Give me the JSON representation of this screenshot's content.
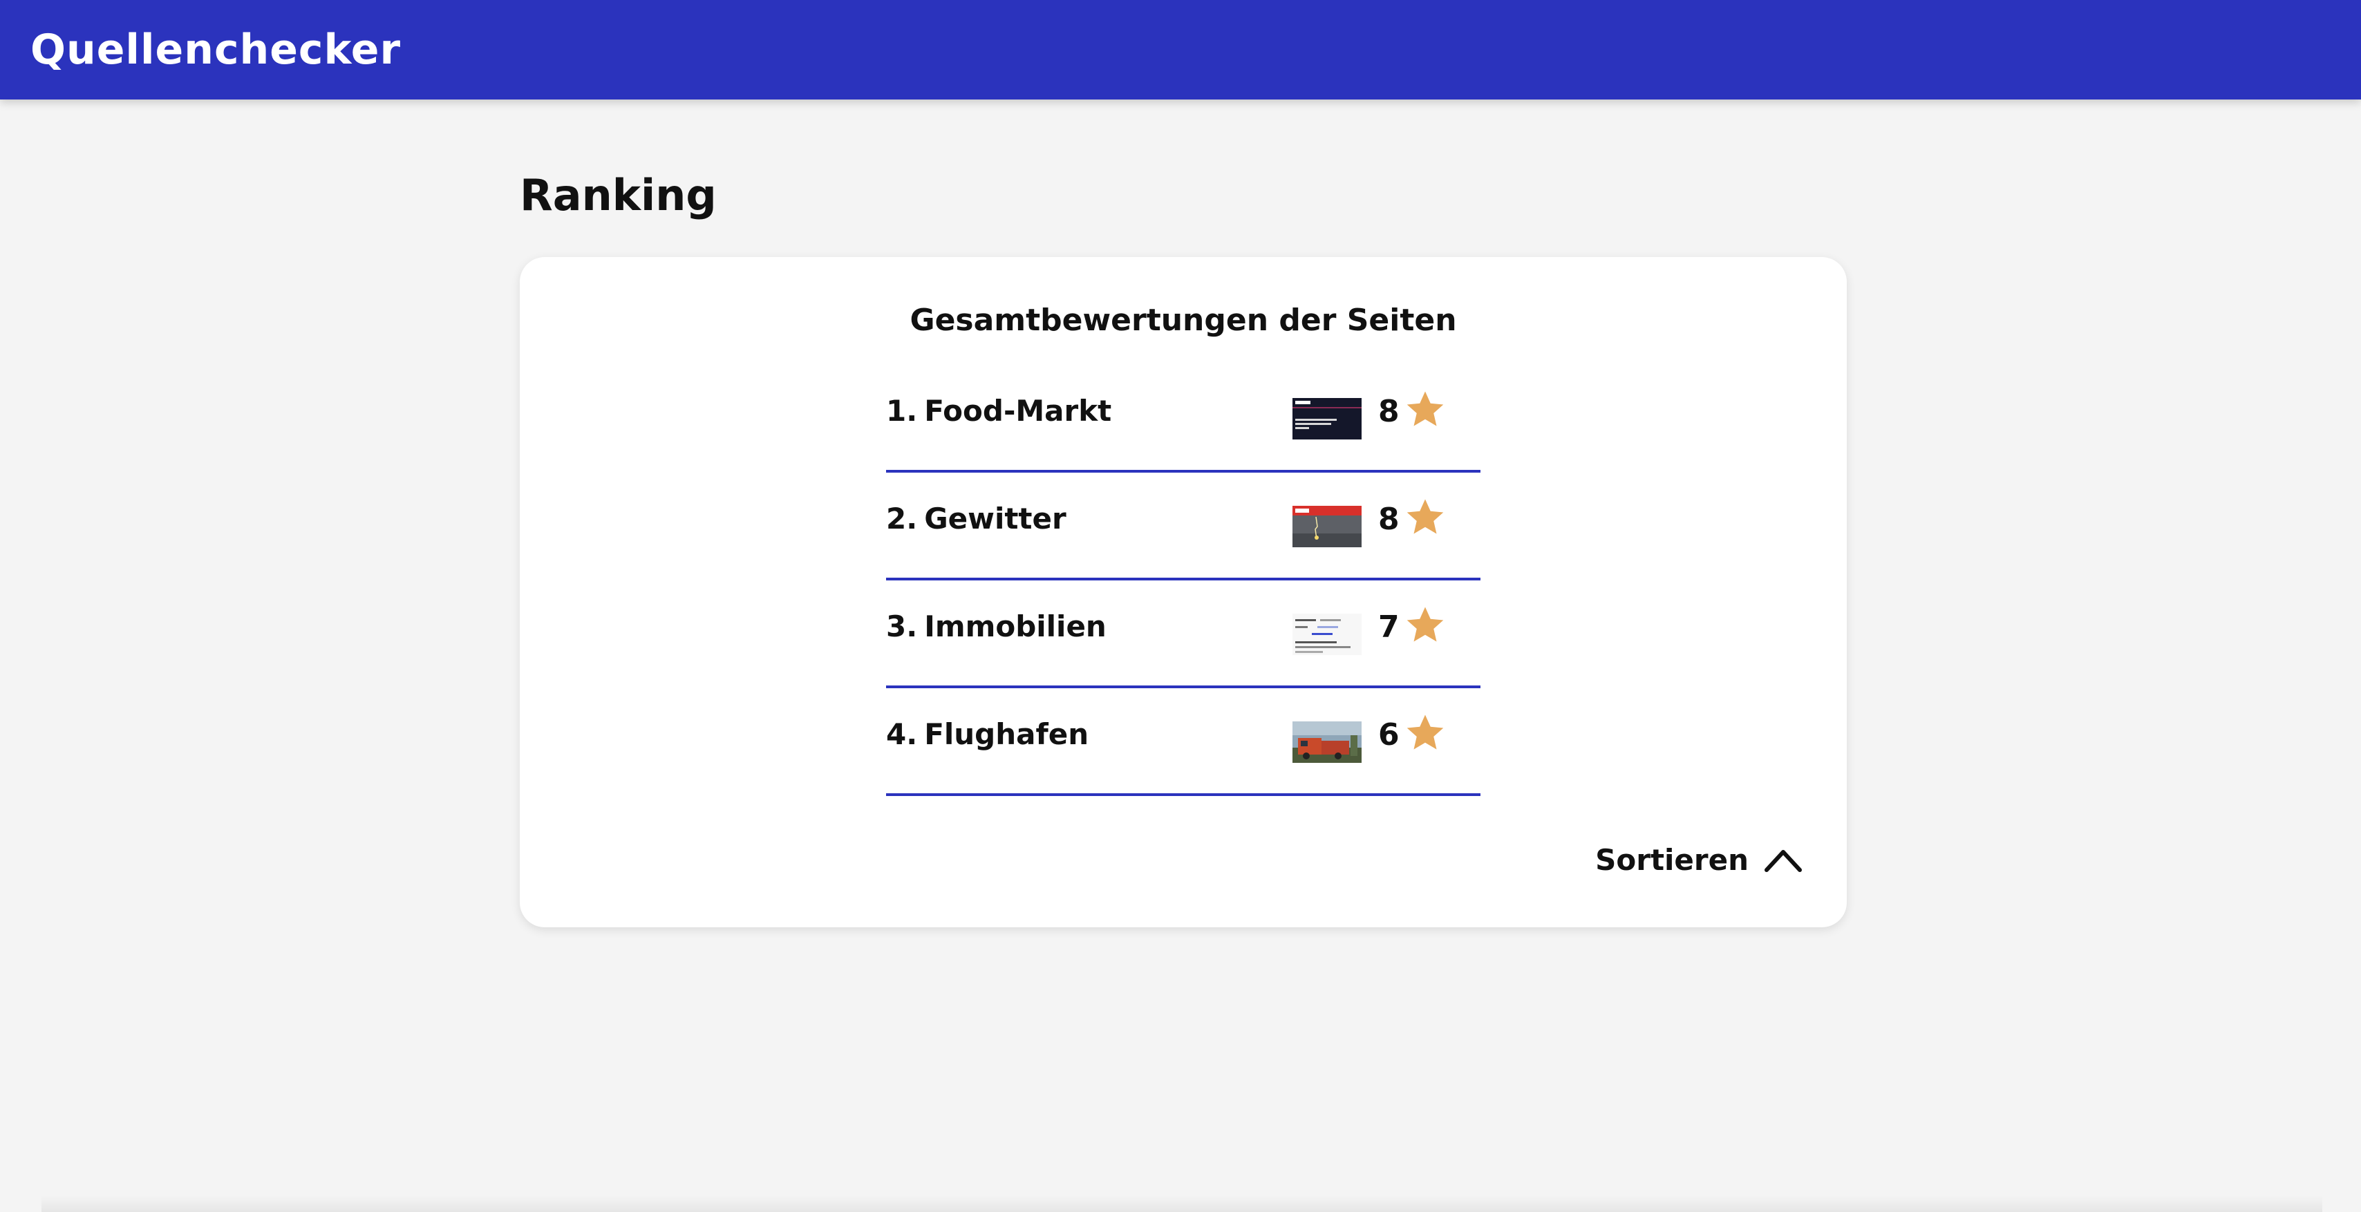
{
  "header": {
    "app_title": "Quellenchecker",
    "color": "#2b33bd"
  },
  "page": {
    "heading": "Ranking"
  },
  "card": {
    "title": "Gesamtbewertungen der Seiten",
    "items": [
      {
        "rank": "1.",
        "name": "Food-Markt",
        "score": "8",
        "thumbnail": "dark-news-page-thumbnail",
        "icon": "star-icon"
      },
      {
        "rank": "2.",
        "name": "Gewitter",
        "score": "8",
        "thumbnail": "red-header-lightning-photo-thumbnail",
        "icon": "star-icon"
      },
      {
        "rank": "3.",
        "name": "Immobilien",
        "score": "7",
        "thumbnail": "light-text-page-thumbnail",
        "icon": "star-icon"
      },
      {
        "rank": "4.",
        "name": "Flughafen",
        "score": "6",
        "thumbnail": "fire-truck-photo-thumbnail",
        "icon": "star-icon"
      }
    ],
    "sort": {
      "label": "Sortieren",
      "icon": "chevron-up-icon"
    }
  },
  "colors": {
    "accent": "#2b33bd",
    "star": "#e7a85a",
    "background": "#f4f4f4",
    "card": "#ffffff"
  }
}
